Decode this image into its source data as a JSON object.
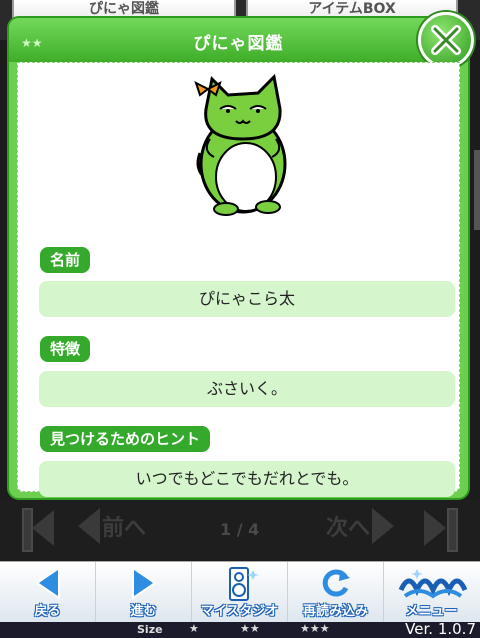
{
  "background_tabs": [
    {
      "label": "ぴにゃ図鑑"
    },
    {
      "label": "アイテムBOX"
    }
  ],
  "modal": {
    "title": "ぴにゃ図鑑",
    "close_icon": "close-x-icon",
    "sections": [
      {
        "label": "名前",
        "value": "ぴにゃこら太"
      },
      {
        "label": "特徴",
        "value": "ぶさいく。"
      },
      {
        "label": "見つけるためのヒント",
        "value": "いつでもどこでもだれとでも。"
      }
    ]
  },
  "pager": {
    "prev_label": "前へ",
    "next_label": "次へ",
    "page_indicator": "1 / 4"
  },
  "menu": {
    "items": [
      {
        "label": "戻る",
        "icon": "back-arrow-icon"
      },
      {
        "label": "進む",
        "icon": "forward-arrow-icon"
      },
      {
        "label": "マイスタジオ",
        "icon": "speaker-icon"
      },
      {
        "label": "再読み込み",
        "icon": "reload-icon"
      },
      {
        "label": "メニュー",
        "icon": "menu-logo-icon"
      }
    ]
  },
  "footer": {
    "size_label": "Size",
    "size_options": [
      "★",
      "★★",
      "★★★"
    ],
    "version": "Ver. 1.0.7"
  },
  "colors": {
    "modal_green": "#6ccf4f",
    "label_green": "#34a92b",
    "value_bg": "#d5f5cc",
    "menu_blue": "#1a5fb4"
  }
}
